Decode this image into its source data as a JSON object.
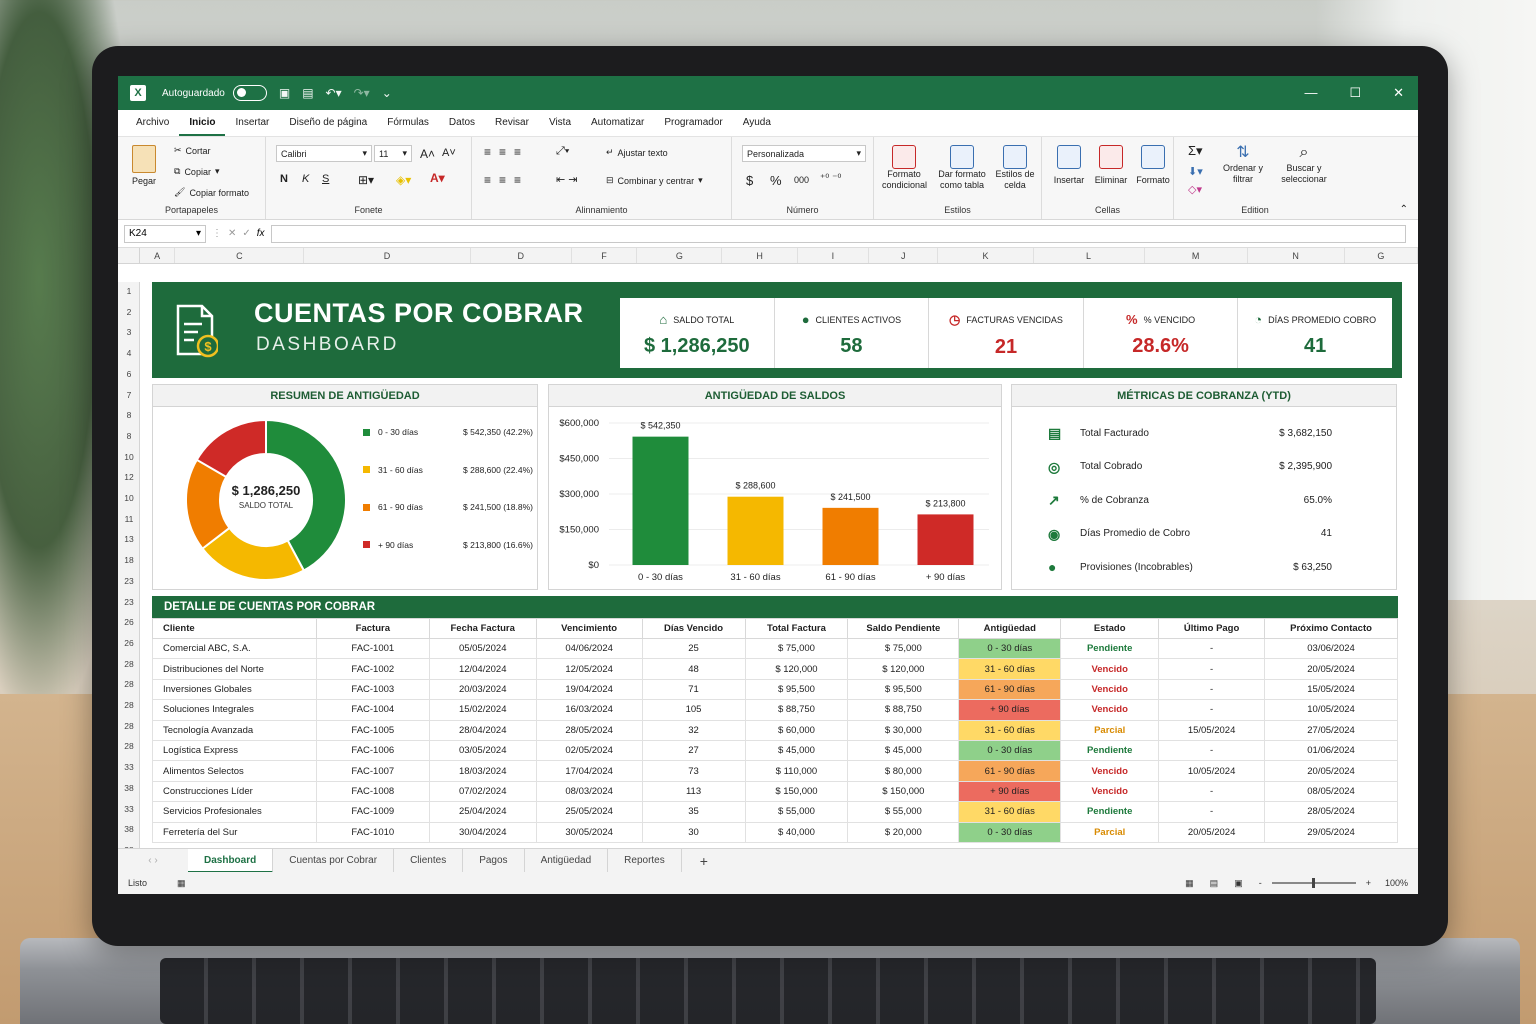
{
  "window": {
    "autosave_label": "Autoguardado",
    "menu_tabs": [
      "Archivo",
      "Inicio",
      "Insertar",
      "Diseño de página",
      "Fórmulas",
      "Datos",
      "Revisar",
      "Vista",
      "Automatizar",
      "Programador",
      "Ayuda"
    ],
    "active_tab": "Inicio"
  },
  "ribbon": {
    "clipboard": {
      "paste": "Pegar",
      "cut": "Cortar",
      "copy": "Copiar",
      "format_painter": "Copiar formato",
      "group": "Portapapeles"
    },
    "font": {
      "name": "Calibri",
      "size": "11",
      "bold": "N",
      "italic": "K",
      "underline": "S",
      "group": "Fonete"
    },
    "alignment": {
      "wrap": "Ajustar texto",
      "merge": "Combinar y centrar",
      "group": "Alinnamiento"
    },
    "number": {
      "format": "Personalizada",
      "currency": "$",
      "percent": "%",
      "thousands": "000",
      "group": "Número"
    },
    "styles": {
      "conditional": "Formato condicional",
      "table": "Dar formato como tabla",
      "cell_styles": "Estilos de celda",
      "group": "Estilos"
    },
    "cells": {
      "insert": "Insertar",
      "delete": "Eliminar",
      "format": "Formato",
      "group": "Cellas"
    },
    "editing": {
      "sort": "Ordenar y filtrar",
      "find": "Buscar y seleccionar",
      "group": "Edition"
    }
  },
  "formula_bar": {
    "name_box": "K24",
    "fx": "fx"
  },
  "columns": [
    "A",
    "C",
    "D",
    "D",
    "F",
    "G",
    "H",
    "I",
    "J",
    "K",
    "L",
    "M",
    "N",
    "G"
  ],
  "rows": [
    "1",
    "2",
    "3",
    "4",
    "6",
    "7",
    "8",
    "8",
    "10",
    "12",
    "10",
    "11",
    "13",
    "18",
    "23",
    "23",
    "26",
    "26",
    "28",
    "28",
    "28",
    "28",
    "28",
    "33",
    "38",
    "33",
    "38",
    "38",
    "30"
  ],
  "banner": {
    "title": "CUENTAS POR COBRAR",
    "subtitle": "DASHBOARD"
  },
  "kpis": [
    {
      "label": "SALDO TOTAL",
      "value": "$ 1,286,250",
      "color": "#1e6b3c",
      "icon": "bank-icon"
    },
    {
      "label": "CLIENTES ACTIVOS",
      "value": "58",
      "color": "#1e6b3c",
      "icon": "user-icon"
    },
    {
      "label": "FACTURAS VENCIDAS",
      "value": "21",
      "color": "#c62828",
      "icon": "clock-alert-icon"
    },
    {
      "label": "% VENCIDO",
      "value": "28.6%",
      "color": "#c62828",
      "icon": "percent-icon"
    },
    {
      "label": "DÍAS PROMEDIO COBRO",
      "value": "41",
      "color": "#1e6b3c",
      "icon": "clock-icon"
    }
  ],
  "aging_summary": {
    "title": "RESUMEN DE ANTIGÜEDAD",
    "center_value": "$ 1,286,250",
    "center_label": "SALDO TOTAL",
    "items": [
      {
        "label": "0 - 30 días",
        "value": "$ 542,350 (42.2%)",
        "color": "#1f8c3b"
      },
      {
        "label": "31 - 60 días",
        "value": "$ 288,600 (22.4%)",
        "color": "#f5b800"
      },
      {
        "label": "61 - 90 días",
        "value": "$ 241,500 (18.8%)",
        "color": "#f07d00"
      },
      {
        "label": "+ 90 días",
        "value": "$ 213,800 (16.6%)",
        "color": "#cf2a27"
      }
    ]
  },
  "chart_data": {
    "type": "bar",
    "title": "ANTIGÜEDAD DE SALDOS",
    "categories": [
      "0 - 30 días",
      "31 - 60 días",
      "61 - 90 días",
      "+ 90 días"
    ],
    "values": [
      542350,
      288600,
      241500,
      213800
    ],
    "value_labels": [
      "$ 542,350",
      "$ 288,600",
      "$ 241,500",
      "$ 213,800"
    ],
    "colors": [
      "#1f8c3b",
      "#f5b800",
      "#f07d00",
      "#cf2a27"
    ],
    "ylim": [
      0,
      600000
    ],
    "yticks": [
      0,
      150000,
      300000,
      450000,
      600000
    ],
    "ytick_labels": [
      "$0",
      "$150,000",
      "$300,000",
      "$450,000",
      "$600,000"
    ]
  },
  "metrics": {
    "title": "MÉTRICAS DE COBRANZA (YTD)",
    "items": [
      {
        "label": "Total Facturado",
        "value": "$ 3,682,150",
        "icon": "invoice-icon"
      },
      {
        "label": "Total Cobrado",
        "value": "$ 2,395,900",
        "icon": "money-cycle-icon"
      },
      {
        "label": "% de Cobranza",
        "value": "65.0%",
        "icon": "chart-up-icon"
      },
      {
        "label": "Días Promedio de Cobro",
        "value": "41",
        "icon": "calendar-cycle-icon"
      },
      {
        "label": "Provisiones (Incobrables)",
        "value": "$ 63,250",
        "icon": "user-alert-icon"
      }
    ]
  },
  "detail": {
    "title": "DETALLE DE CUENTAS POR COBRAR",
    "headers": [
      "Cliente",
      "Factura",
      "Fecha Factura",
      "Vencimiento",
      "Días Vencido",
      "Total Factura",
      "Saldo Pendiente",
      "Antigüedad",
      "Estado",
      "Último Pago",
      "Próximo Contacto"
    ],
    "aging_colors": {
      "0 - 30 días": "#8fd08a",
      "31 - 60 días": "#ffd966",
      "61 - 90 días": "#f6a75a",
      "+ 90 días": "#ec6b5f"
    },
    "rows": [
      [
        "Comercial ABC, S.A.",
        "FAC-1001",
        "05/05/2024",
        "04/06/2024",
        "25",
        "$ 75,000",
        "$ 75,000",
        "0 - 30 días",
        "Pendiente",
        "-",
        "03/06/2024"
      ],
      [
        "Distribuciones del Norte",
        "FAC-1002",
        "12/04/2024",
        "12/05/2024",
        "48",
        "$ 120,000",
        "$ 120,000",
        "31 - 60 días",
        "Vencido",
        "-",
        "20/05/2024"
      ],
      [
        "Inversiones Globales",
        "FAC-1003",
        "20/03/2024",
        "19/04/2024",
        "71",
        "$ 95,500",
        "$ 95,500",
        "61 - 90 días",
        "Vencido",
        "-",
        "15/05/2024"
      ],
      [
        "Soluciones Integrales",
        "FAC-1004",
        "15/02/2024",
        "16/03/2024",
        "105",
        "$ 88,750",
        "$ 88,750",
        "+ 90 días",
        "Vencido",
        "-",
        "10/05/2024"
      ],
      [
        "Tecnología Avanzada",
        "FAC-1005",
        "28/04/2024",
        "28/05/2024",
        "32",
        "$ 60,000",
        "$ 30,000",
        "31 - 60 días",
        "Parcial",
        "15/05/2024",
        "27/05/2024"
      ],
      [
        "Logística Express",
        "FAC-1006",
        "03/05/2024",
        "02/05/2024",
        "27",
        "$ 45,000",
        "$ 45,000",
        "0 - 30 días",
        "Pendiente",
        "-",
        "01/06/2024"
      ],
      [
        "Alimentos Selectos",
        "FAC-1007",
        "18/03/2024",
        "17/04/2024",
        "73",
        "$ 110,000",
        "$ 80,000",
        "61 - 90 días",
        "Vencido",
        "10/05/2024",
        "20/05/2024"
      ],
      [
        "Construcciones Líder",
        "FAC-1008",
        "07/02/2024",
        "08/03/2024",
        "113",
        "$ 150,000",
        "$ 150,000",
        "+ 90 días",
        "Vencido",
        "-",
        "08/05/2024"
      ],
      [
        "Servicios Profesionales",
        "FAC-1009",
        "25/04/2024",
        "25/05/2024",
        "35",
        "$ 55,000",
        "$ 55,000",
        "31 - 60 días",
        "Pendiente",
        "-",
        "28/05/2024"
      ],
      [
        "Ferretería del Sur",
        "FAC-1010",
        "30/04/2024",
        "30/05/2024",
        "30",
        "$ 40,000",
        "$ 20,000",
        "0 - 30 días",
        "Parcial",
        "20/05/2024",
        "29/05/2024"
      ]
    ]
  },
  "sheet_tabs": [
    "Dashboard",
    "Cuentas por Cobrar",
    "Clientes",
    "Pagos",
    "Antigüedad",
    "Reportes"
  ],
  "add_sheet": "+",
  "status": {
    "ready": "Listo",
    "zoom": "100%",
    "zoom_out": "-",
    "zoom_in": "+"
  }
}
